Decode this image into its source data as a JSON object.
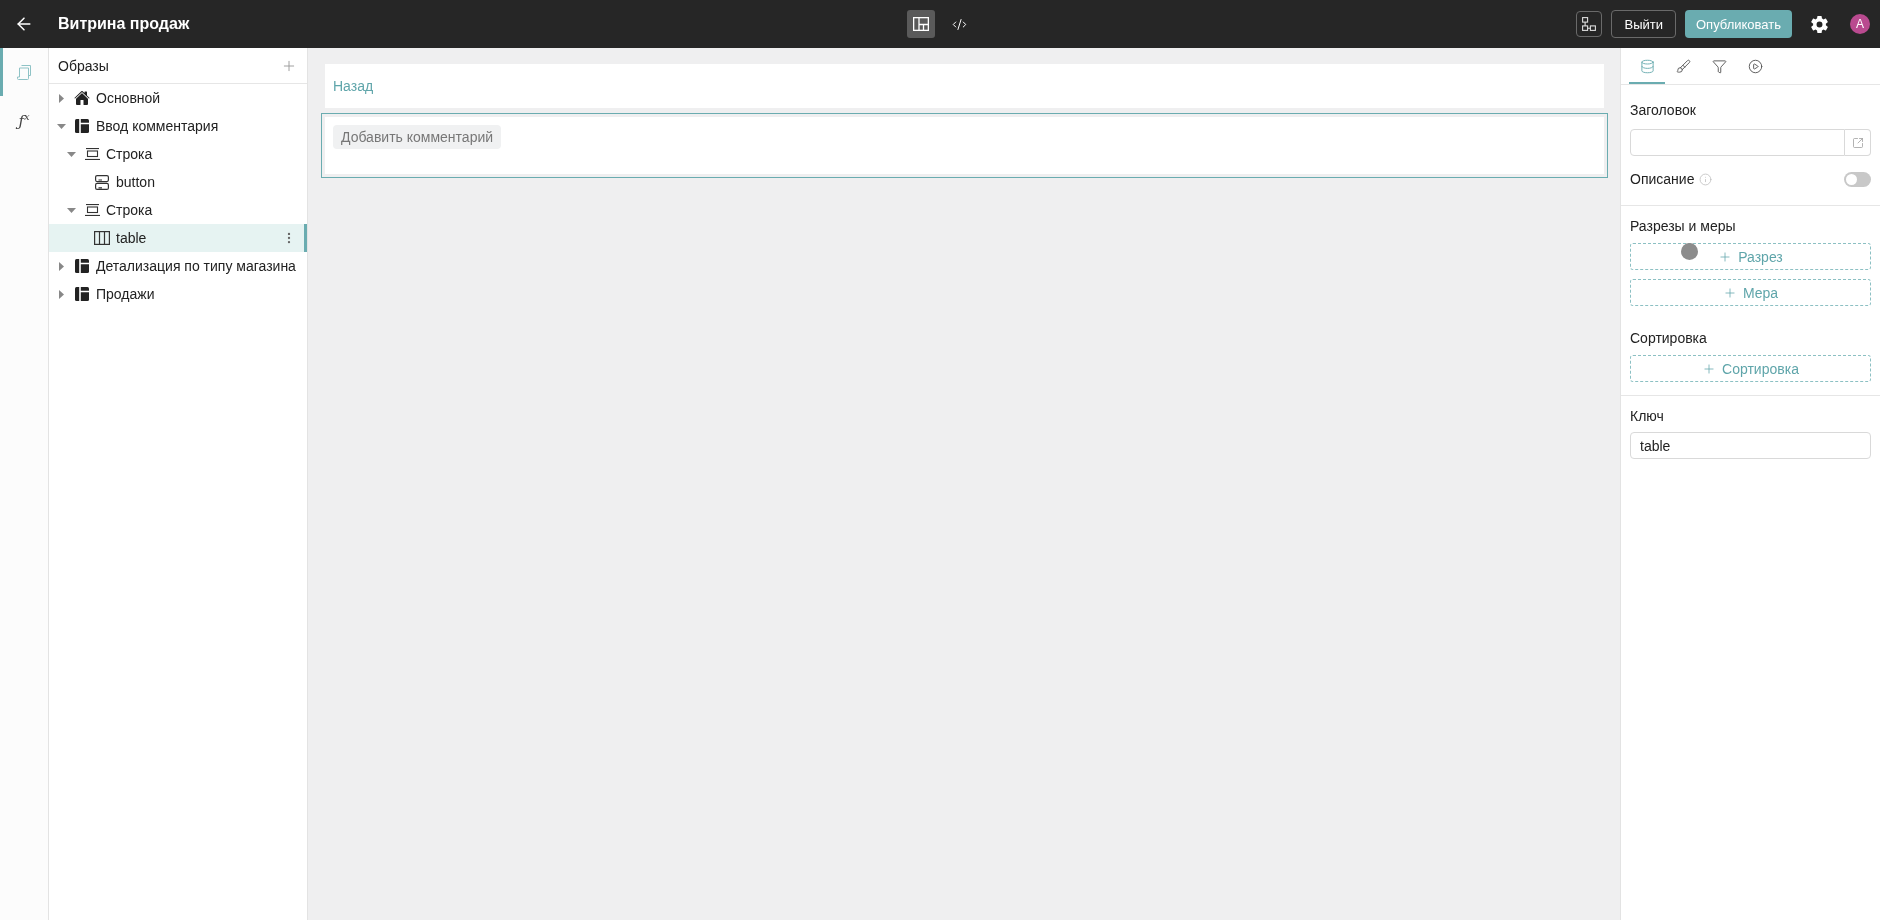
{
  "header": {
    "title": "Витрина продаж",
    "view_modes": [
      {
        "kind": "layout",
        "selected": true
      },
      {
        "kind": "code",
        "selected": false
      }
    ],
    "actions": [
      {
        "kind": "outline",
        "label": "Выйти"
      },
      {
        "kind": "primary",
        "label": "Опубликовать"
      }
    ],
    "avatar": "A"
  },
  "rail": {
    "items": [
      {
        "kind": "pages",
        "selected": true
      },
      {
        "kind": "formula",
        "symbol": "ƒ$^{x}$",
        "selected": false
      }
    ]
  },
  "tree": {
    "title": "Образы",
    "items": [
      {
        "kind": "home",
        "label": "Основной",
        "expanded": false,
        "selected": false
      },
      {
        "kind": "page",
        "label": "Ввод комментария",
        "expanded": true,
        "selected": false,
        "children": [
          {
            "kind": "row",
            "label": "Строка",
            "expanded": true,
            "selected": false,
            "children": [
              {
                "kind": "button",
                "label": "button",
                "selected": false
              }
            ]
          },
          {
            "kind": "row",
            "label": "Строка",
            "expanded": true,
            "selected": false,
            "children": [
              {
                "kind": "table",
                "label": "table",
                "selected": true
              }
            ]
          }
        ]
      },
      {
        "kind": "page",
        "label": "Детализация по типу магазина",
        "expanded": false,
        "selected": false
      },
      {
        "kind": "page",
        "label": "Продажи",
        "expanded": false,
        "selected": false
      }
    ]
  },
  "canvas": {
    "blocks": [
      {
        "kind": "link",
        "text": "Назад",
        "selected": false
      },
      {
        "kind": "button",
        "text": "Добавить комментарий",
        "selected": true
      }
    ]
  },
  "properties": {
    "tabs": [
      {
        "kind": "data",
        "selected": true
      },
      {
        "kind": "style",
        "selected": false
      },
      {
        "kind": "filter",
        "selected": false
      },
      {
        "kind": "action",
        "selected": false
      }
    ],
    "title_field": {
      "label": "Заголовок"
    },
    "description": {
      "label": "Описание",
      "on": false
    },
    "groups": [
      {
        "title": "Разрезы и меры",
        "add_buttons": [
          "Разрез",
          "Мера"
        ]
      },
      {
        "title": "Сортировка",
        "add_buttons": [
          "Сортировка"
        ]
      }
    ],
    "key_field": {
      "label": "Ключ",
      "value": "table"
    }
  }
}
